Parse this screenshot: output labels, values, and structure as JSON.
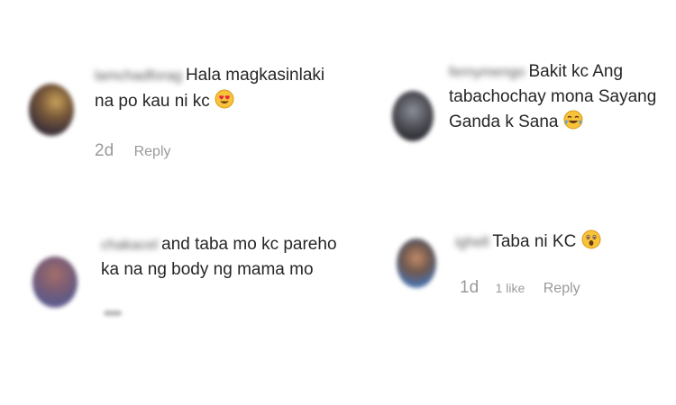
{
  "comments": [
    {
      "username": "lamchadforag",
      "line1": "Hala magkasinlaki",
      "line2": "na po kau ni kc",
      "emoji": "heart-eyes-emoji",
      "time": "2d",
      "reply": "Reply"
    },
    {
      "username": "fernymengo",
      "line1": "Bakit kc Ang",
      "line2": "tabachochay mona Sayang",
      "line3": "Ganda k Sana",
      "emoji": "tears-of-joy-emoji"
    },
    {
      "username": "chakacel",
      "line1": "and taba mo kc pareho",
      "line2": "ka na ng body ng mama mo"
    },
    {
      "username": "ighell",
      "line1": "Taba ni KC",
      "emoji": "astonished-emoji",
      "time": "1d",
      "likes": "1 like",
      "reply": "Reply"
    }
  ]
}
